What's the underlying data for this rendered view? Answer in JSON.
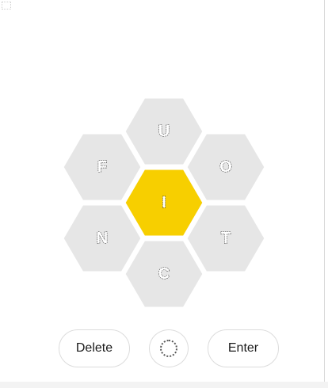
{
  "hive": {
    "center_letter": "I",
    "outer_letters": {
      "top": "U",
      "upper_left": "F",
      "upper_right": "O",
      "lower_left": "N",
      "lower_right": "T",
      "bottom": "C"
    }
  },
  "controls": {
    "delete_label": "Delete",
    "enter_label": "Enter",
    "shuffle_icon": "shuffle-icon"
  },
  "colors": {
    "center_cell": "#f7cf00",
    "outer_cell": "#e6e6e6",
    "button_border": "#dcdcdc"
  }
}
